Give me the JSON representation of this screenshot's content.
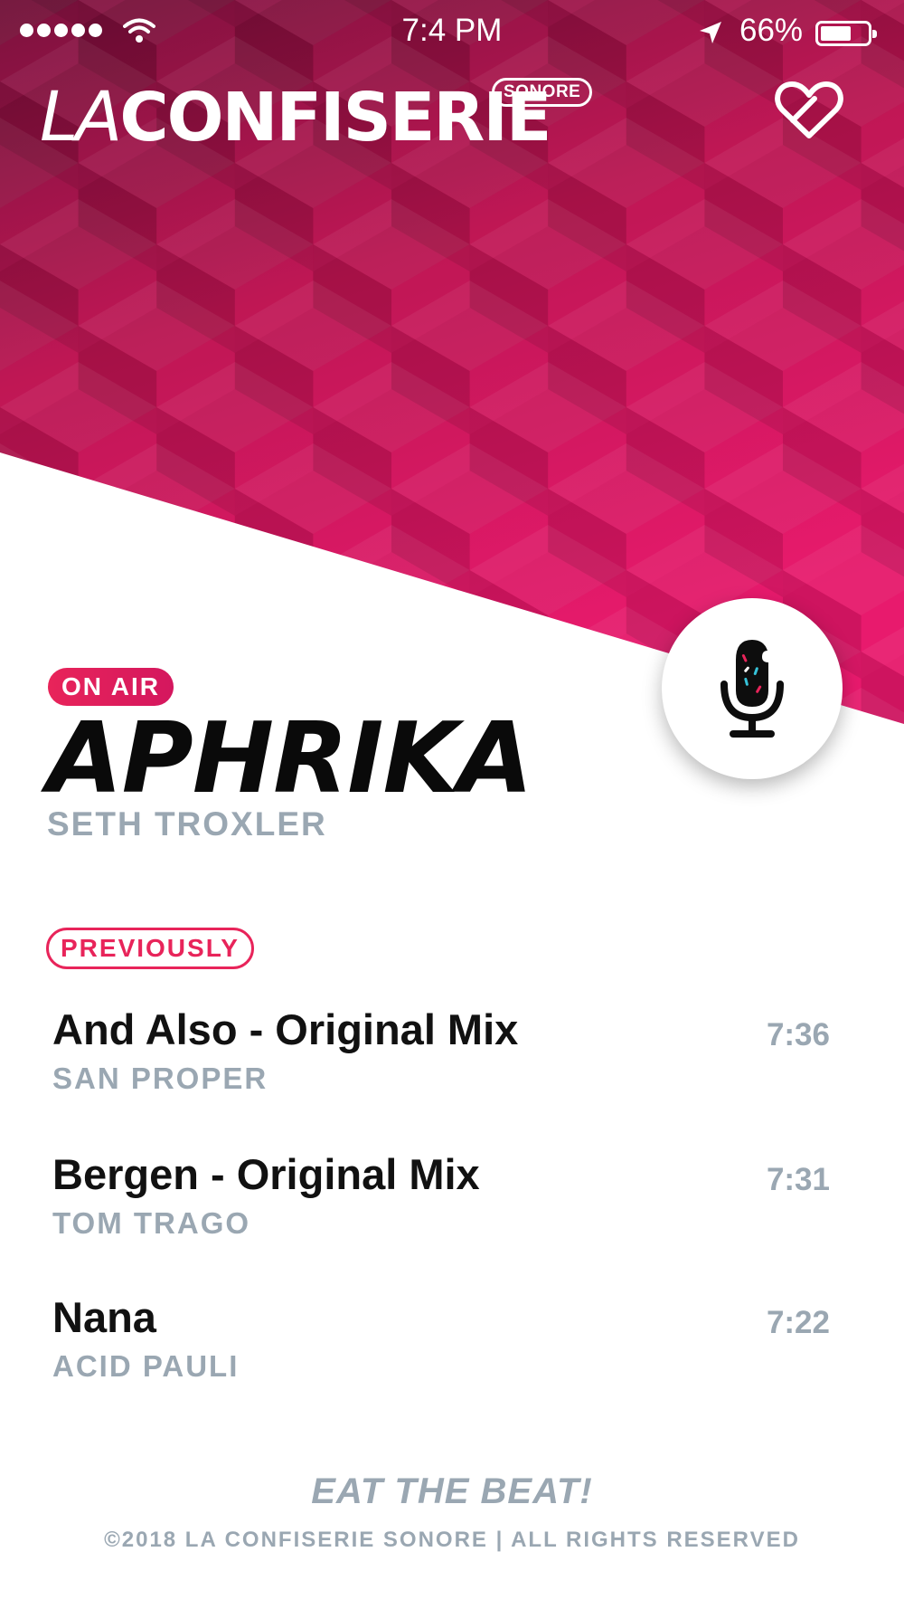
{
  "status_bar": {
    "time": "7:4 PM",
    "battery": "66%",
    "battery_level": 0.66
  },
  "header": {
    "logo_la": "LA",
    "logo_main": "CONFISERIE",
    "logo_badge": "SONORE"
  },
  "icons": {
    "favorite": "heart-icon",
    "live": "microphone-icon",
    "location": "location-arrow-icon",
    "wifi": "wifi-icon"
  },
  "colors": {
    "accent": "#e8245a",
    "hero_pink": "#e0135d",
    "hero_dark": "#8a1040",
    "muted_text": "#9aa7b2",
    "title_text": "#0a0a0a"
  },
  "now_playing": {
    "badge": "ON AIR",
    "title": "APHRIKA",
    "artist": "SETH TROXLER"
  },
  "previously": {
    "label": "PREVIOUSLY",
    "tracks": [
      {
        "title": "And Also - Original Mix",
        "artist": "SAN PROPER",
        "time": "7:36"
      },
      {
        "title": "Bergen - Original Mix",
        "artist": "TOM TRAGO",
        "time": "7:31"
      },
      {
        "title": "Nana",
        "artist": "ACID PAULI",
        "time": "7:22"
      }
    ]
  },
  "footer": {
    "tagline": "EAT THE BEAT!",
    "copyright": "©2018 LA CONFISERIE SONORE | ALL RIGHTS RESERVED"
  }
}
